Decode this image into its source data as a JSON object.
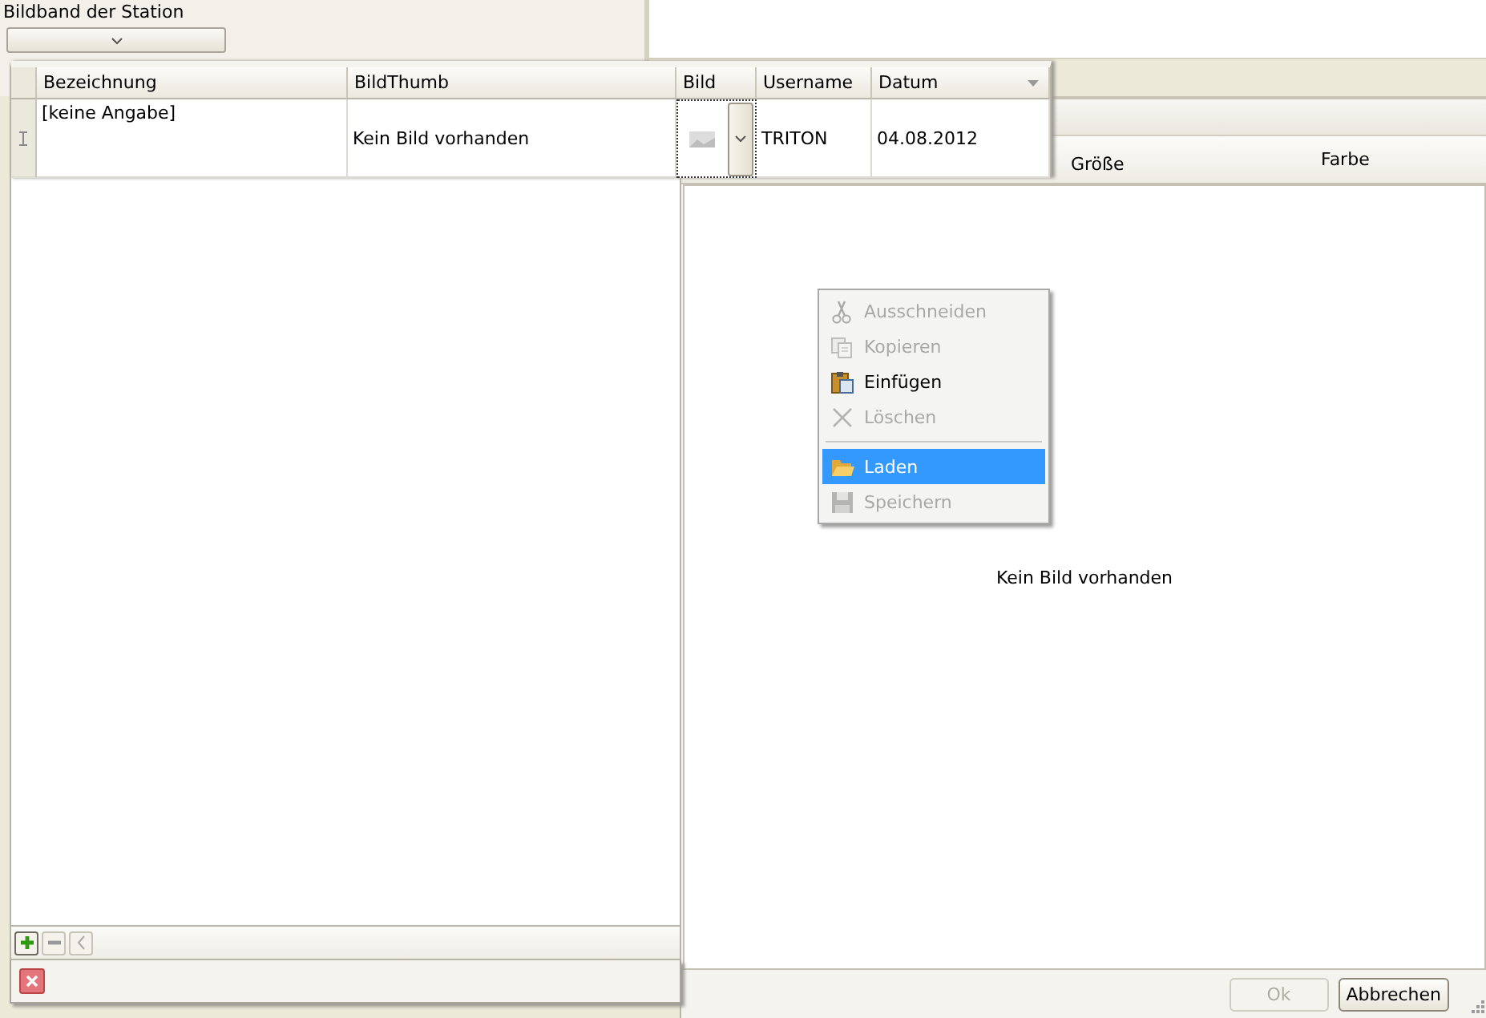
{
  "background_window": {
    "label": "Bildband der Station"
  },
  "image_dialog": {
    "columns": [
      "Größe",
      "Farbe"
    ],
    "empty_text": "Kein Bild vorhanden",
    "buttons": [
      {
        "label": "Ok",
        "disabled": true
      },
      {
        "label": "Abbrechen",
        "disabled": false
      }
    ]
  },
  "grid": {
    "columns": [
      {
        "label": "Bezeichnung",
        "dropdown": false
      },
      {
        "label": "BildThumb",
        "dropdown": false
      },
      {
        "label": "Bild",
        "dropdown": false
      },
      {
        "label": "Username",
        "dropdown": false
      },
      {
        "label": "Datum",
        "dropdown": true
      }
    ],
    "rows": [
      {
        "bezeichnung": "[keine Angabe]",
        "bildthumb": "Kein Bild vorhanden",
        "username": "TRITON",
        "datum": "04.08.2012",
        "editing": true
      }
    ],
    "navigator": [
      {
        "kind": "add",
        "disabled": false
      },
      {
        "kind": "remove",
        "disabled": true
      },
      {
        "kind": "prev",
        "disabled": true
      }
    ]
  },
  "context_menu": [
    {
      "kind": "cut",
      "label": "Ausschneiden",
      "disabled": true,
      "selected": false
    },
    {
      "kind": "copy",
      "label": "Kopieren",
      "disabled": true,
      "selected": false
    },
    {
      "kind": "paste",
      "label": "Einfügen",
      "disabled": false,
      "selected": false
    },
    {
      "kind": "delete",
      "label": "Löschen",
      "disabled": true,
      "selected": false
    },
    {
      "kind": "separator"
    },
    {
      "kind": "load",
      "label": "Laden",
      "disabled": false,
      "selected": true
    },
    {
      "kind": "save",
      "label": "Speichern",
      "disabled": true,
      "selected": false
    }
  ]
}
